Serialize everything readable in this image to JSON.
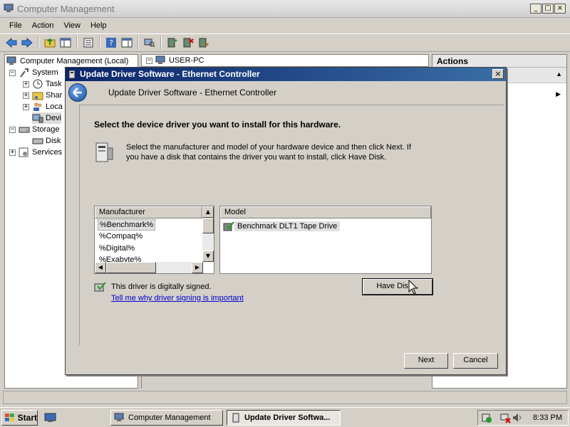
{
  "main_window": {
    "title": "Computer Management",
    "menu": [
      "File",
      "Action",
      "View",
      "Help"
    ],
    "window_buttons": [
      "_",
      "□",
      "×"
    ]
  },
  "tree": {
    "root": "Computer Management (Local)",
    "items": [
      {
        "label": "System",
        "expander": "−"
      },
      {
        "label": "Task",
        "expander": "+"
      },
      {
        "label": "Shar",
        "expander": "+"
      },
      {
        "label": "Loca",
        "expander": "+"
      },
      {
        "label": "Devi",
        "expander": ""
      },
      {
        "label": "Storage",
        "expander": "−"
      },
      {
        "label": "Disk",
        "expander": ""
      },
      {
        "label": "Services",
        "expander": "+"
      }
    ]
  },
  "center": {
    "header": "USER-PC",
    "expander": "−"
  },
  "actions": {
    "header": "Actions"
  },
  "dialog": {
    "title": "Update Driver Software - Ethernet Controller",
    "header_title": "Update Driver Software - Ethernet Controller",
    "heading": "Select the device driver you want to install for this hardware.",
    "info_text": "Select the manufacturer and model of your hardware device and then click Next. If you have a disk that contains the driver you want to install, click Have Disk.",
    "manufacturer_header": "Manufacturer",
    "manufacturers": [
      "%Benchmark%",
      "%Compaq%",
      "%Digital%",
      "%Exabyte%"
    ],
    "model_header": "Model",
    "models": [
      "Benchmark DLT1 Tape Drive"
    ],
    "signed_text": "This driver is digitally signed.",
    "signed_link": "Tell me why driver signing is important",
    "have_disk_label": "Have Disk...",
    "next_label": "Next",
    "cancel_label": "Cancel",
    "close_label": "×"
  },
  "taskbar": {
    "start_label": "Start",
    "tasks": [
      "Computer Management",
      "Update Driver Softwa..."
    ],
    "clock": "8:33 PM"
  }
}
